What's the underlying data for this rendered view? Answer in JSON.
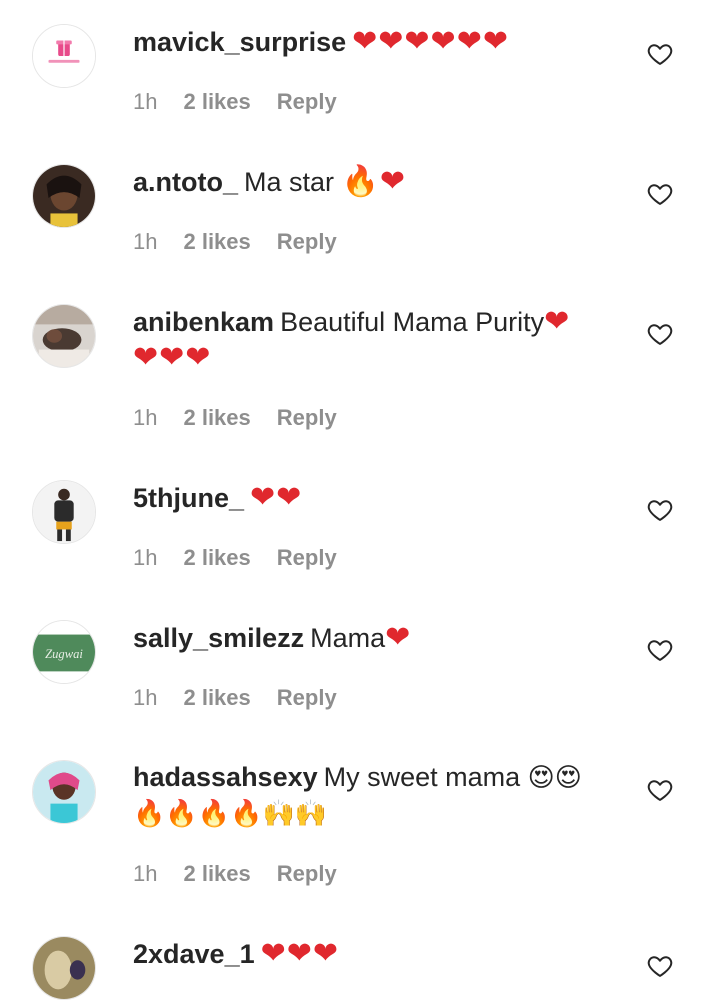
{
  "colors": {
    "heart": "#e0282e",
    "muted": "#8e8e8e",
    "text": "#262626"
  },
  "comments": [
    {
      "username": "mavick_surprise",
      "text": "",
      "emoji": "❤❤❤❤❤❤",
      "line2": "",
      "time": "1h",
      "likes": "2 likes",
      "reply": "Reply",
      "avatar": "mavick-surprise-logo"
    },
    {
      "username": "a.ntoto_",
      "text": "Ma star ",
      "emoji": "🔥❤",
      "line2": "",
      "time": "1h",
      "likes": "2 likes",
      "reply": "Reply",
      "avatar": "photo"
    },
    {
      "username": "anibenkam",
      "text": "Beautiful Mama Purity",
      "emoji": "❤",
      "line2": "❤❤❤",
      "time": "1h",
      "likes": "2 likes",
      "reply": "Reply",
      "avatar": "photo"
    },
    {
      "username": "5thjune_",
      "text": "",
      "emoji": "❤❤",
      "line2": "",
      "time": "1h",
      "likes": "2 likes",
      "reply": "Reply",
      "avatar": "photo"
    },
    {
      "username": "sally_smilezz",
      "text": "Mama",
      "emoji": "❤",
      "line2": "",
      "time": "1h",
      "likes": "2 likes",
      "reply": "Reply",
      "avatar": "zugwai-sign"
    },
    {
      "username": "hadassahsexy",
      "text": "My sweet mama ",
      "emoji": "😍😍",
      "line2": "🔥🔥🔥🔥🙌🙌",
      "time": "1h",
      "likes": "2 likes",
      "reply": "Reply",
      "avatar": "photo"
    },
    {
      "username": "2xdave_1",
      "text": "",
      "emoji": "❤❤❤",
      "line2": "",
      "time": "",
      "likes": "",
      "reply": "",
      "avatar": "photo"
    }
  ],
  "avatar_texts": {
    "zugwai": "Zugwai"
  },
  "icons": {
    "like": "heart-outline-icon"
  }
}
